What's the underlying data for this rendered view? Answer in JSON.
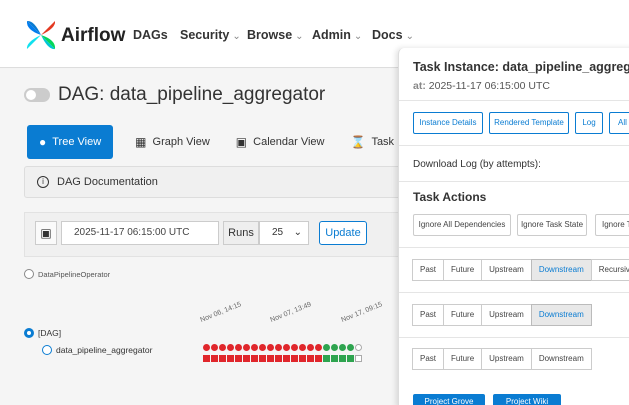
{
  "navbar": {
    "brand": "Airflow",
    "items": [
      {
        "label": "DAGs",
        "caret": ""
      },
      {
        "label": "Security",
        "caret": "⌄"
      },
      {
        "label": "Browse",
        "caret": "⌄"
      },
      {
        "label": "Admin",
        "caret": "⌄"
      },
      {
        "label": "Docs",
        "caret": "⌄"
      }
    ]
  },
  "dag": {
    "prefix": "DAG:",
    "name": "data_pipeline_aggregator"
  },
  "tabs": [
    "Tree View",
    "Graph View",
    "Calendar View",
    "Task Duration"
  ],
  "doc_label": "DAG Documentation",
  "controls": {
    "date_value": "2025-11-17 06:15:00 UTC",
    "runs_label": "Runs",
    "runs_value": "25",
    "update_label": "Update"
  },
  "operator_label": "DataPipelineOperator",
  "tree": {
    "root_label": "[DAG]",
    "child_label": "data_pipeline_aggregator",
    "date_labels": [
      "Nov 06, 14:15",
      "Nov 07, 13:49",
      "Nov 17, 09:15"
    ],
    "run_states": [
      "failed",
      "failed",
      "failed",
      "failed",
      "failed",
      "failed",
      "failed",
      "failed",
      "failed",
      "failed",
      "failed",
      "failed",
      "failed",
      "failed",
      "failed",
      "success",
      "success",
      "success",
      "success",
      "none"
    ],
    "task_states": [
      "failed",
      "failed",
      "failed",
      "failed",
      "failed",
      "failed",
      "failed",
      "failed",
      "failed",
      "failed",
      "failed",
      "failed",
      "failed",
      "failed",
      "failed",
      "success",
      "success",
      "success",
      "success",
      "none"
    ]
  },
  "colors": {
    "accent": "#0a7cd2",
    "failed": "#e0262b",
    "success": "#2ea44f",
    "none": "#ffffff"
  },
  "panel": {
    "title": "Task Instance: data_pipeline_aggregator",
    "at_label": "at:",
    "at_value": "2025-11-17 06:15:00 UTC",
    "buttons": [
      "Instance Details",
      "Rendered Template",
      "Log",
      "All"
    ],
    "download_log": "Download Log (by attempts):",
    "task_actions": "Task Actions",
    "ignore_buttons": [
      "Ignore All Dependencies",
      "Ignore Task State",
      "Ignore Ta"
    ],
    "seg1": [
      "Past",
      "Future",
      "Upstream",
      "Downstream",
      "Recursive"
    ],
    "seg2": [
      "Past",
      "Future",
      "Upstream",
      "Downstream"
    ],
    "seg3": [
      "Past",
      "Future",
      "Upstream",
      "Downstream"
    ],
    "bottom_buttons": [
      "Project Grove",
      "Project Wiki"
    ]
  }
}
